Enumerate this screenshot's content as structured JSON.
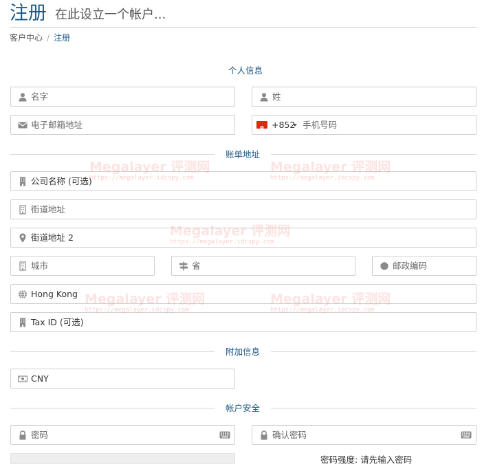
{
  "header": {
    "title": "注册",
    "subtitle": "在此设立一个帐户..."
  },
  "breadcrumb": {
    "home": "客户中心",
    "separator": "/",
    "current": "注册"
  },
  "sections": {
    "personal": "个人信息",
    "billing": "账单地址",
    "additional": "附加信息",
    "security": "帐户安全"
  },
  "personal": {
    "first_name_placeholder": "名字",
    "last_name_placeholder": "姓",
    "email_placeholder": "电子邮箱地址",
    "phone_code": "+852",
    "phone_placeholder": "手机号码",
    "phone_flag_color": "#de2910"
  },
  "billing": {
    "company_placeholder": "公司名称 (可选)",
    "street1_placeholder": "街道地址",
    "street2_placeholder": "街道地址 2",
    "city_placeholder": "城市",
    "state_placeholder": "省",
    "postcode_placeholder": "邮政编码",
    "country_value": "Hong Kong",
    "taxid_placeholder": "Tax ID (可选)"
  },
  "additional": {
    "currency_value": "CNY"
  },
  "security": {
    "password_placeholder": "密码",
    "confirm_placeholder": "确认密码",
    "strength_label": "密码强度: 请先输入密码",
    "strength_level": 0
  },
  "watermark": {
    "brand": "Megalayer 评测网",
    "url": "https://megalayer.idcspy.com"
  },
  "colors": {
    "accent": "#1d5a86",
    "icon": "#8a8a8a"
  }
}
